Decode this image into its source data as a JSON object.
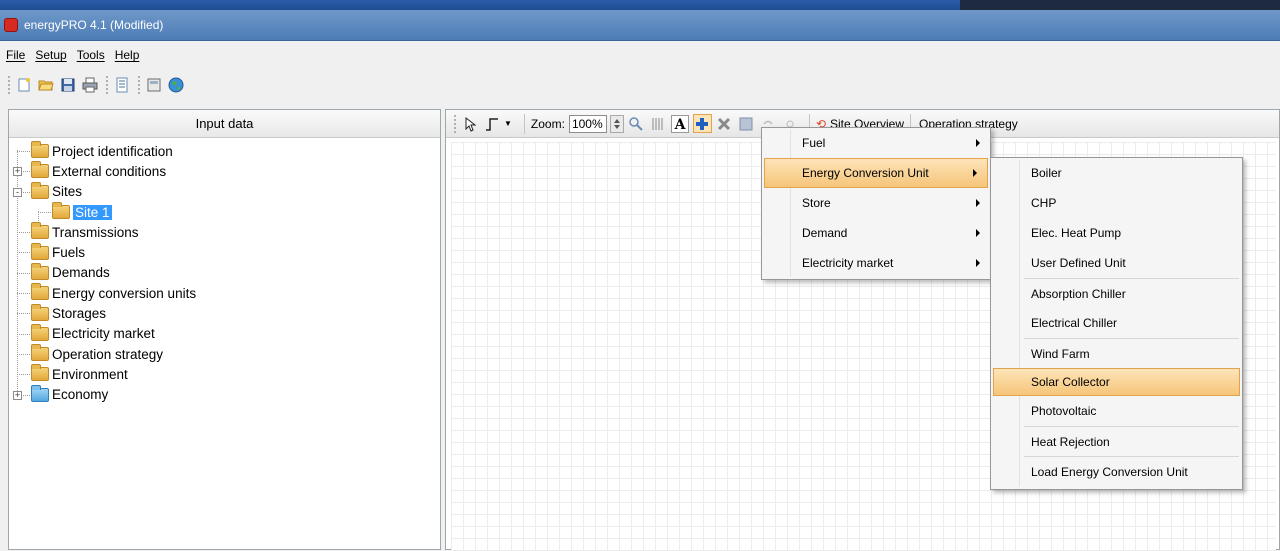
{
  "window": {
    "title": "energyPRO 4.1 (Modified)"
  },
  "menubar": [
    "File",
    "Setup",
    "Tools",
    "Help"
  ],
  "toolbar": {
    "icons": [
      "new-icon",
      "open-icon",
      "save-icon",
      "print-icon",
      "report-icon",
      "calculator-icon",
      "globe-icon"
    ]
  },
  "left_panel": {
    "header": "Input data",
    "tree": [
      {
        "label": "Project identification",
        "level": 0,
        "expander": ""
      },
      {
        "label": "External conditions",
        "level": 0,
        "expander": "+"
      },
      {
        "label": "Sites",
        "level": 0,
        "expander": "-"
      },
      {
        "label": "Site 1",
        "level": 1,
        "expander": "",
        "selected": true
      },
      {
        "label": "Transmissions",
        "level": 0,
        "expander": ""
      },
      {
        "label": "Fuels",
        "level": 0,
        "expander": ""
      },
      {
        "label": "Demands",
        "level": 0,
        "expander": ""
      },
      {
        "label": "Energy conversion units",
        "level": 0,
        "expander": ""
      },
      {
        "label": "Storages",
        "level": 0,
        "expander": ""
      },
      {
        "label": "Electricity market",
        "level": 0,
        "expander": ""
      },
      {
        "label": "Operation strategy",
        "level": 0,
        "expander": ""
      },
      {
        "label": "Environment",
        "level": 0,
        "expander": ""
      },
      {
        "label": "Economy",
        "level": 0,
        "expander": "+",
        "icon": "check"
      }
    ]
  },
  "right_toolbar": {
    "zoom_label": "Zoom:",
    "zoom_value": "100%",
    "site_overview": "Site Overview",
    "operation_strategy": "Operation strategy"
  },
  "add_menu": {
    "items": [
      "Fuel",
      "Energy Conversion Unit",
      "Store",
      "Demand",
      "Electricity market"
    ],
    "highlighted": "Energy Conversion Unit"
  },
  "ecu_submenu": {
    "items": [
      "Boiler",
      "CHP",
      "Elec. Heat Pump",
      "User Defined Unit",
      "Absorption Chiller",
      "Electrical Chiller",
      "Wind Farm",
      "Solar Collector",
      "Photovoltaic",
      "Heat Rejection",
      "Load Energy Conversion Unit"
    ],
    "highlighted": "Solar Collector"
  },
  "colors": {
    "title_bar": "#5a88c0",
    "menu_highlight": "#f6c579",
    "tree_selection": "#3399ff"
  }
}
